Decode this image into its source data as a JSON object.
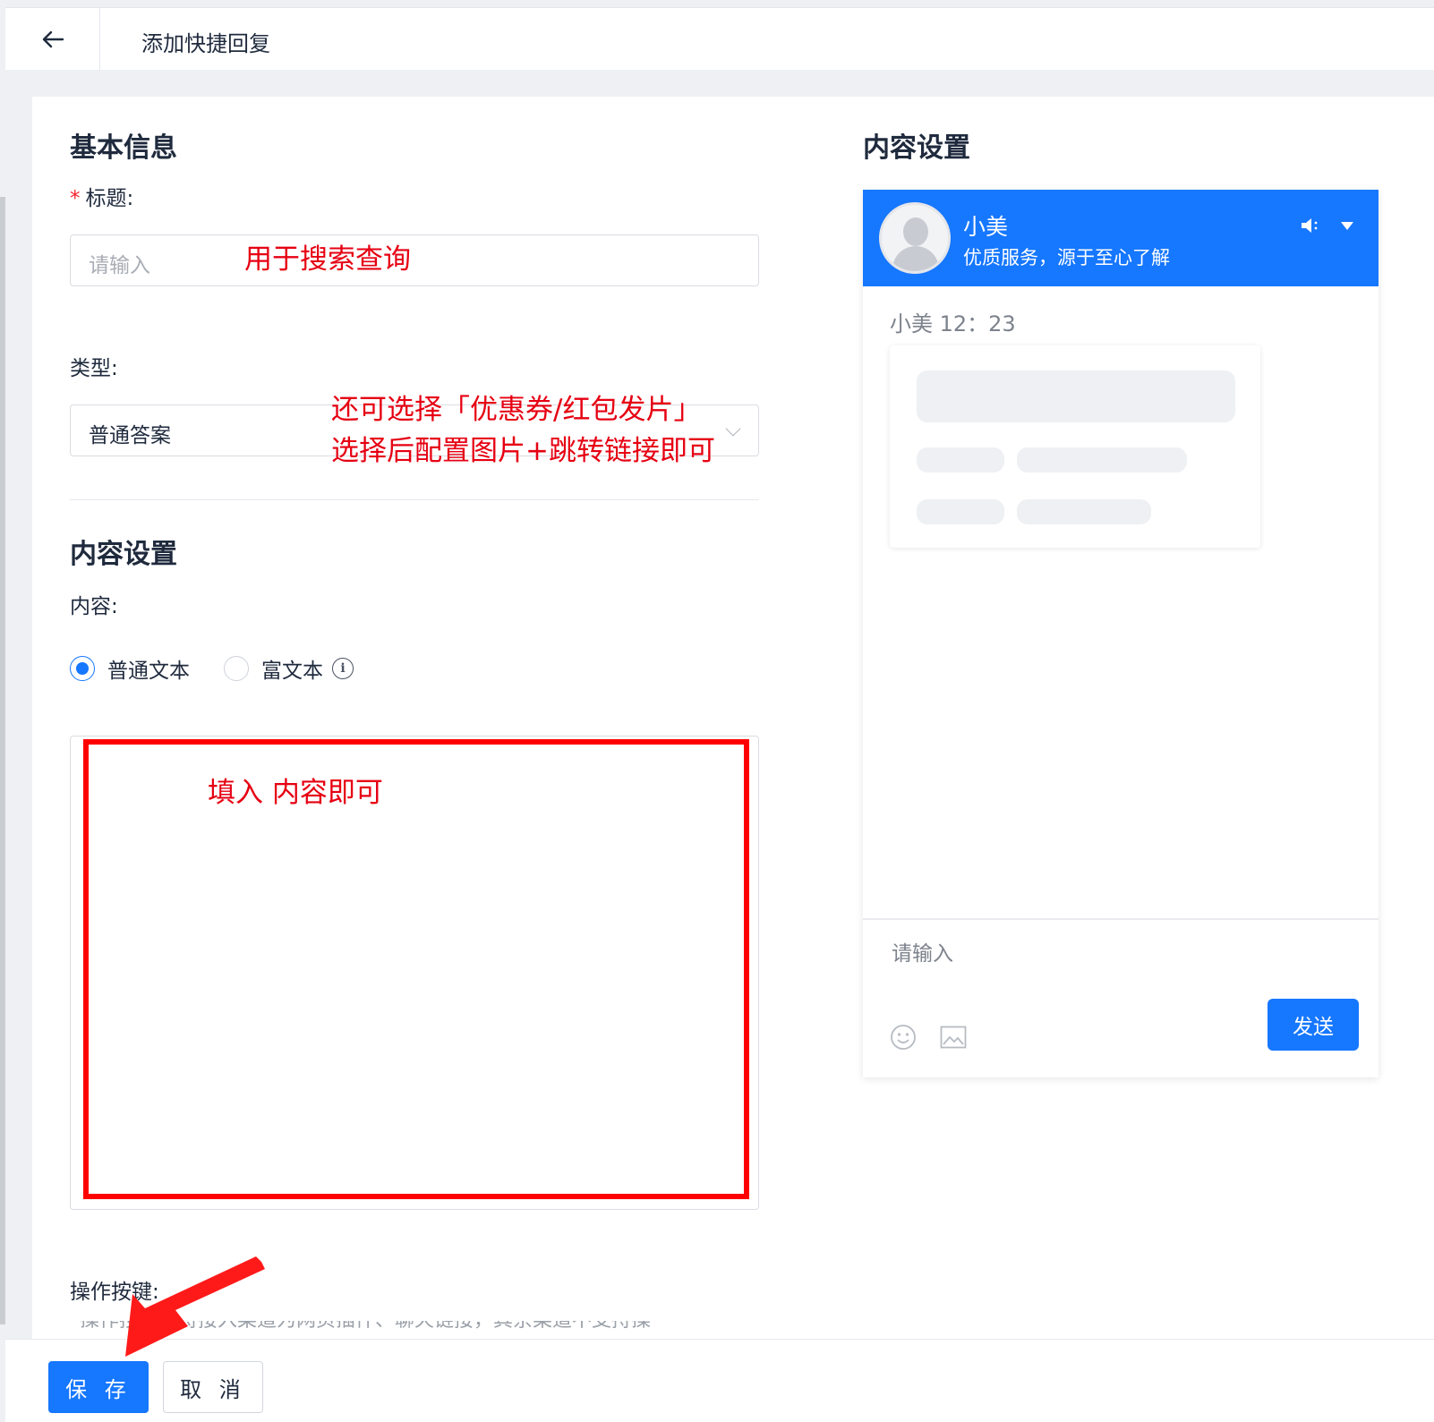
{
  "header": {
    "title": "添加快捷回复"
  },
  "basic": {
    "section_title": "基本信息",
    "title_field": {
      "required_mark": "*",
      "label": "标题:",
      "placeholder": "请输入"
    },
    "type_field": {
      "label": "类型:",
      "value": "普通答案"
    }
  },
  "content": {
    "section_title": "内容设置",
    "label": "内容:",
    "options": [
      {
        "label": "普通文本",
        "selected": true
      },
      {
        "label": "富文本",
        "selected": false
      }
    ],
    "info_glyph": "i"
  },
  "operations": {
    "label": "操作按键:",
    "note": "*操作按键支持接入渠道为网页插件、聊天链接，其余渠道不支持操"
  },
  "preview": {
    "section_title": "内容设置",
    "agent_name": "小美",
    "slogan": "优质服务，源于至心了解",
    "time_label": "小美 12：23",
    "input_placeholder": "请输入",
    "send_label": "发送"
  },
  "annotations": {
    "title_hint": "用于搜索查询",
    "type_hint_1": "还可选择「优惠券/红包发片」",
    "type_hint_2": "选择后配置图片+跳转链接即可",
    "content_hint": "填入 内容即可"
  },
  "footer": {
    "save_label": "保 存",
    "cancel_label": "取 消"
  },
  "colors": {
    "primary": "#1677ff",
    "annotation": "#e60012",
    "required": "#f5222d"
  }
}
